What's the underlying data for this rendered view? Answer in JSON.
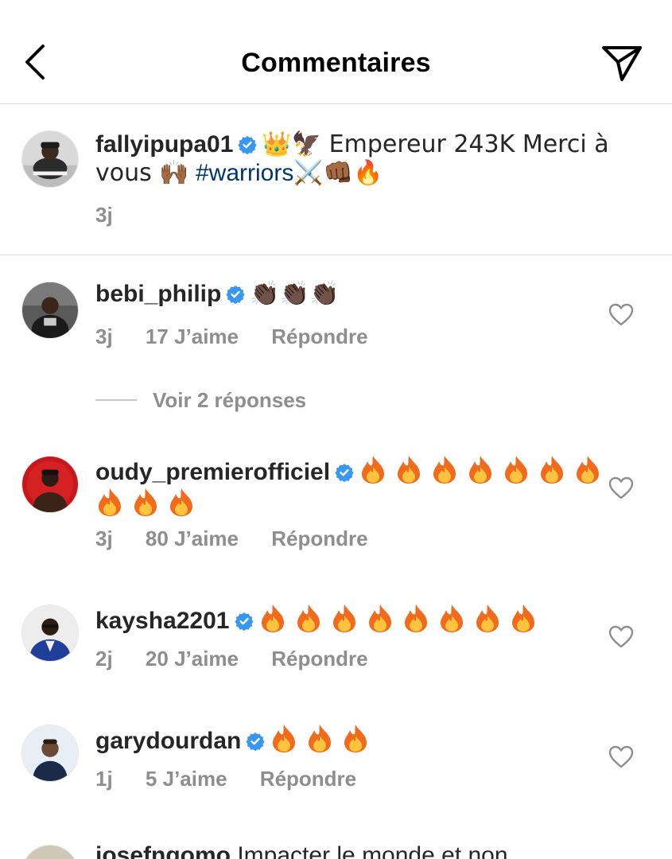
{
  "header": {
    "title": "Commentaires",
    "back_icon": "chevron-left-icon",
    "send_icon": "paper-plane-icon"
  },
  "caption": {
    "username": "fallyipupa01",
    "verified": true,
    "text_part1": "👑🦅 Empereur 243K Merci à vous 🙌🏾",
    "hashtag": "#warriors",
    "text_part2": "⚔️👊🏾",
    "fire": "🔥",
    "time": "3j"
  },
  "comments": [
    {
      "username": "bebi_philip",
      "verified": true,
      "text": "👏🏿👏🏿👏🏿",
      "fire_count": 0,
      "time": "3j",
      "likes": "17 J’aime",
      "reply": "Répondre",
      "view_replies": "Voir 2 réponses"
    },
    {
      "username": "oudy_premierofficiel",
      "verified": true,
      "text": "",
      "fire_count": 10,
      "time": "3j",
      "likes": "80 J’aime",
      "reply": "Répondre"
    },
    {
      "username": "kaysha2201",
      "verified": true,
      "text": "",
      "fire_count": 8,
      "time": "2j",
      "likes": "20 J’aime",
      "reply": "Répondre"
    },
    {
      "username": "garydourdan",
      "verified": true,
      "text": "",
      "fire_count": 3,
      "time": "1j",
      "likes": "5 J’aime",
      "reply": "Répondre"
    },
    {
      "username": "josefngomo",
      "verified": false,
      "text": "Impacter le monde et non",
      "time": "",
      "likes": "",
      "reply": ""
    }
  ],
  "colors": {
    "text": "#262626",
    "secondary": "#8e8e8e",
    "verified": "#3897f0",
    "hashtag": "#00376b",
    "divider": "#dbdbdb"
  }
}
